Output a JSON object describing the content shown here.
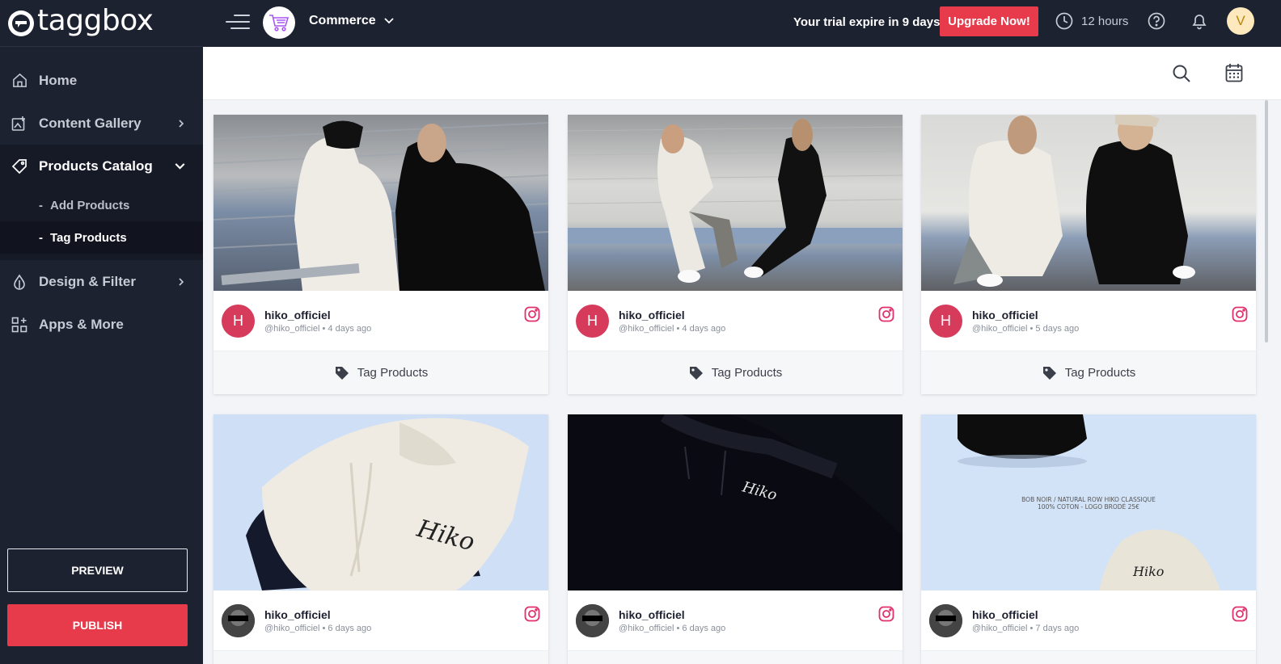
{
  "brand": {
    "name": "taggbox"
  },
  "sidebar": {
    "items": [
      {
        "label": "Home"
      },
      {
        "label": "Content Gallery"
      },
      {
        "label": "Products Catalog"
      },
      {
        "label": "Design & Filter"
      },
      {
        "label": "Apps & More"
      }
    ],
    "subitems": [
      {
        "label": "Add Products"
      },
      {
        "label": "Tag Products"
      }
    ],
    "preview_label": "PREVIEW",
    "publish_label": "PUBLISH"
  },
  "topbar": {
    "workspace": "Commerce",
    "trial_text": "Your trial expire in 9 days.",
    "upgrade_label": "Upgrade Now!",
    "time_label": "12 hours",
    "avatar_initial": "V"
  },
  "colors": {
    "sidebar_bg": "#1d2231",
    "accent_red": "#e73a4a",
    "avatar_pink": "#d63b5c",
    "instagram": "#e1306c"
  },
  "posts": [
    {
      "username": "hiko_officiel",
      "handle": "@hiko_officiel",
      "age": "4 days ago",
      "avatar_letter": "H",
      "action": "Tag Products"
    },
    {
      "username": "hiko_officiel",
      "handle": "@hiko_officiel",
      "age": "4 days ago",
      "avatar_letter": "H",
      "action": "Tag Products"
    },
    {
      "username": "hiko_officiel",
      "handle": "@hiko_officiel",
      "age": "5 days ago",
      "avatar_letter": "H",
      "action": "Tag Products"
    },
    {
      "username": "hiko_officiel",
      "handle": "@hiko_officiel",
      "age": "6 days ago",
      "avatar_letter": "",
      "action": ""
    },
    {
      "username": "hiko_officiel",
      "handle": "@hiko_officiel",
      "age": "6 days ago",
      "avatar_letter": "",
      "action": ""
    },
    {
      "username": "hiko_officiel",
      "handle": "@hiko_officiel",
      "age": "7 days ago",
      "avatar_letter": "",
      "action": ""
    }
  ],
  "photo_texts": {
    "signature": "Hiko",
    "bucket_caption_1": "BOB NOIR / NATURAL ROW HIKO CLASSIQUE",
    "bucket_caption_2": "100% COTON - LOGO BRODÉ 25€"
  }
}
